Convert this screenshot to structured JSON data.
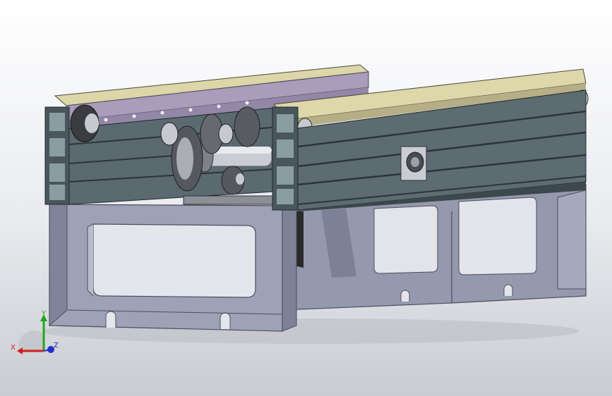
{
  "view": {
    "background_top": "#ffffff",
    "background_bottom": "#c9ccd1",
    "colors": {
      "frame_gray": "#8f95a8",
      "frame_dark": "#5f6479",
      "frame_light": "#b4b8c8",
      "profile_dark": "#3e4a4e",
      "profile_mid": "#5c6b70",
      "rail_tan": "#d8d2a4",
      "rail_purple": "#a89cb4",
      "metal": "#c7cad0"
    }
  },
  "triad": {
    "x_label": "X",
    "y_label": "Y",
    "z_label": "Z",
    "x_color": "#d42020",
    "y_color": "#1fa81f",
    "z_color": "#2030c8"
  }
}
